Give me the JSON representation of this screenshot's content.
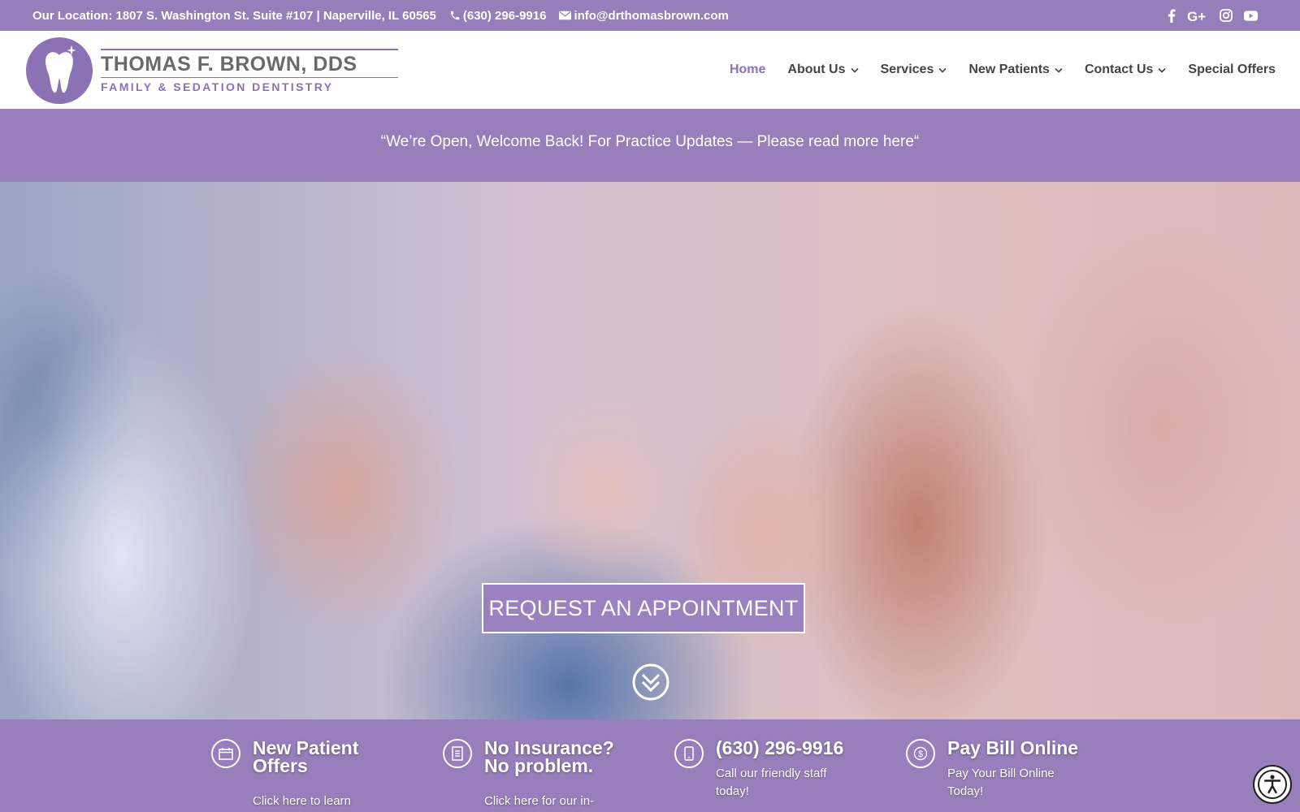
{
  "topbar": {
    "location": "Our Location: 1807 S. Washington St. Suite #107 | Naperville, IL 60565",
    "phone": "(630) 296-9916",
    "email": "info@drthomasbrown.com",
    "social": [
      "facebook-icon",
      "google-plus-icon",
      "instagram-icon",
      "youtube-icon"
    ]
  },
  "logo": {
    "name": "THOMAS F. BROWN, DDS",
    "subtitle": "FAMILY & SEDATION DENTISTRY"
  },
  "nav": {
    "items": [
      {
        "label": "Home",
        "active": true,
        "dropdown": false
      },
      {
        "label": "About Us",
        "active": false,
        "dropdown": true
      },
      {
        "label": "Services",
        "active": false,
        "dropdown": true
      },
      {
        "label": "New Patients",
        "active": false,
        "dropdown": true
      },
      {
        "label": "Contact Us",
        "active": false,
        "dropdown": true
      },
      {
        "label": "Special Offers",
        "active": false,
        "dropdown": false
      }
    ]
  },
  "announcement": "“We’re Open, Welcome Back! For Practice Updates — Please read more here“",
  "hero": {
    "cta_label": "REQUEST AN APPOINTMENT"
  },
  "features": [
    {
      "icon": "calendar-icon",
      "title_line1": "New Patient",
      "title_line2": "Offers",
      "text_line1": "Click here to learn",
      "text_line2": ""
    },
    {
      "icon": "document-icon",
      "title_line1": "No Insurance?",
      "title_line2": "No problem.",
      "text_line1": "Click here for our in-",
      "text_line2": ""
    },
    {
      "icon": "mobile-phone-icon",
      "title_line1": "(630) 296-9916",
      "title_line2": "",
      "text_line1": "Call our friendly staff",
      "text_line2": "today!"
    },
    {
      "icon": "dollar-icon",
      "title_line1": "Pay Bill Online",
      "title_line2": "",
      "text_line1": "Pay Your Bill Online",
      "text_line2": "Today!"
    }
  ],
  "colors": {
    "brand_purple": "#977fbb",
    "nav_active": "#8a72b5",
    "text_dark": "#444444"
  }
}
